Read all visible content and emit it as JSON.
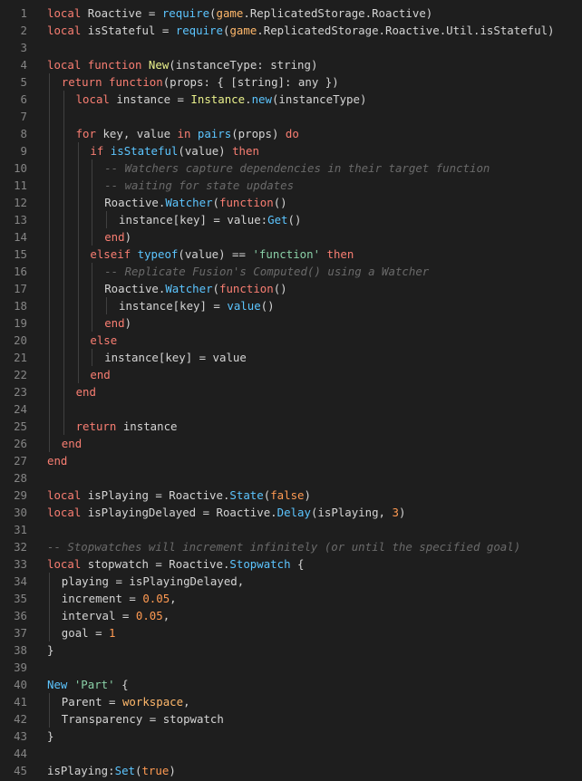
{
  "editor": {
    "language": "Luau",
    "lines": [
      {
        "n": "1",
        "indent": 0,
        "tokens": [
          [
            "kw",
            "local "
          ],
          [
            "",
            "Roactive = "
          ],
          [
            "bi",
            "require"
          ],
          [
            "",
            "("
          ],
          [
            "gm",
            "game"
          ],
          [
            "",
            ".ReplicatedStorage.Roactive)"
          ]
        ]
      },
      {
        "n": "2",
        "indent": 0,
        "tokens": [
          [
            "kw",
            "local "
          ],
          [
            "",
            "isStateful = "
          ],
          [
            "bi",
            "require"
          ],
          [
            "",
            "("
          ],
          [
            "gm",
            "game"
          ],
          [
            "",
            ".ReplicatedStorage.Roactive.Util.isStateful)"
          ]
        ]
      },
      {
        "n": "3",
        "indent": 0,
        "tokens": []
      },
      {
        "n": "4",
        "indent": 0,
        "tokens": [
          [
            "kw",
            "local function "
          ],
          [
            "fn",
            "New"
          ],
          [
            "",
            "(instanceType: "
          ],
          [
            "typ",
            "string"
          ],
          [
            "",
            ")"
          ]
        ]
      },
      {
        "n": "5",
        "indent": 1,
        "tokens": [
          [
            "kw",
            "return function"
          ],
          [
            "",
            "(props: { ["
          ],
          [
            "typ",
            "string"
          ],
          [
            "",
            "]: "
          ],
          [
            "typ",
            "any"
          ],
          [
            "",
            " })"
          ]
        ]
      },
      {
        "n": "6",
        "indent": 2,
        "tokens": [
          [
            "kw",
            "local "
          ],
          [
            "",
            "instance = "
          ],
          [
            "fn",
            "Instance"
          ],
          [
            "",
            "."
          ],
          [
            "bi",
            "new"
          ],
          [
            "",
            "(instanceType)"
          ]
        ]
      },
      {
        "n": "7",
        "indent": 2,
        "tokens": []
      },
      {
        "n": "8",
        "indent": 2,
        "tokens": [
          [
            "kw",
            "for "
          ],
          [
            "",
            "key, value "
          ],
          [
            "kw",
            "in "
          ],
          [
            "bi",
            "pairs"
          ],
          [
            "",
            "(props) "
          ],
          [
            "kw",
            "do"
          ]
        ]
      },
      {
        "n": "9",
        "indent": 3,
        "tokens": [
          [
            "kw",
            "if "
          ],
          [
            "bi",
            "isStateful"
          ],
          [
            "",
            "(value) "
          ],
          [
            "kw",
            "then"
          ]
        ]
      },
      {
        "n": "10",
        "indent": 4,
        "tokens": [
          [
            "cmt",
            "-- Watchers capture dependencies in their target function"
          ]
        ]
      },
      {
        "n": "11",
        "indent": 4,
        "tokens": [
          [
            "cmt",
            "-- waiting for state updates"
          ]
        ]
      },
      {
        "n": "12",
        "indent": 4,
        "tokens": [
          [
            "",
            "Roactive."
          ],
          [
            "bi",
            "Watcher"
          ],
          [
            "",
            "("
          ],
          [
            "kw",
            "function"
          ],
          [
            "",
            "()"
          ]
        ]
      },
      {
        "n": "13",
        "indent": 5,
        "tokens": [
          [
            "",
            "instance[key] = value:"
          ],
          [
            "bi",
            "Get"
          ],
          [
            "",
            "()"
          ]
        ]
      },
      {
        "n": "14",
        "indent": 4,
        "tokens": [
          [
            "kw",
            "end"
          ],
          [
            "",
            ")"
          ]
        ]
      },
      {
        "n": "15",
        "indent": 3,
        "tokens": [
          [
            "kw",
            "elseif "
          ],
          [
            "bi",
            "typeof"
          ],
          [
            "",
            "(value) == "
          ],
          [
            "str",
            "'function'"
          ],
          [
            "kw",
            " then"
          ]
        ]
      },
      {
        "n": "16",
        "indent": 4,
        "tokens": [
          [
            "cmt",
            "-- Replicate Fusion's Computed() using a Watcher"
          ]
        ]
      },
      {
        "n": "17",
        "indent": 4,
        "tokens": [
          [
            "",
            "Roactive."
          ],
          [
            "bi",
            "Watcher"
          ],
          [
            "",
            "("
          ],
          [
            "kw",
            "function"
          ],
          [
            "",
            "()"
          ]
        ]
      },
      {
        "n": "18",
        "indent": 5,
        "tokens": [
          [
            "",
            "instance[key] = "
          ],
          [
            "bi",
            "value"
          ],
          [
            "",
            "()"
          ]
        ]
      },
      {
        "n": "19",
        "indent": 4,
        "tokens": [
          [
            "kw",
            "end"
          ],
          [
            "",
            ")"
          ]
        ]
      },
      {
        "n": "20",
        "indent": 3,
        "tokens": [
          [
            "kw",
            "else"
          ]
        ]
      },
      {
        "n": "21",
        "indent": 4,
        "tokens": [
          [
            "",
            "instance[key] = value"
          ]
        ]
      },
      {
        "n": "22",
        "indent": 3,
        "tokens": [
          [
            "kw",
            "end"
          ]
        ]
      },
      {
        "n": "23",
        "indent": 2,
        "tokens": [
          [
            "kw",
            "end"
          ]
        ]
      },
      {
        "n": "24",
        "indent": 2,
        "tokens": []
      },
      {
        "n": "25",
        "indent": 2,
        "tokens": [
          [
            "kw",
            "return "
          ],
          [
            "",
            "instance"
          ]
        ]
      },
      {
        "n": "26",
        "indent": 1,
        "tokens": [
          [
            "kw",
            "end"
          ]
        ]
      },
      {
        "n": "27",
        "indent": 0,
        "tokens": [
          [
            "kw",
            "end"
          ]
        ]
      },
      {
        "n": "28",
        "indent": 0,
        "tokens": []
      },
      {
        "n": "29",
        "indent": 0,
        "tokens": [
          [
            "kw",
            "local "
          ],
          [
            "",
            "isPlaying = Roactive."
          ],
          [
            "bi",
            "State"
          ],
          [
            "",
            "("
          ],
          [
            "num",
            "false"
          ],
          [
            "",
            ")"
          ]
        ]
      },
      {
        "n": "30",
        "indent": 0,
        "tokens": [
          [
            "kw",
            "local "
          ],
          [
            "",
            "isPlayingDelayed = Roactive."
          ],
          [
            "bi",
            "Delay"
          ],
          [
            "",
            "(isPlaying, "
          ],
          [
            "num",
            "3"
          ],
          [
            "",
            ")"
          ]
        ]
      },
      {
        "n": "31",
        "indent": 0,
        "tokens": []
      },
      {
        "n": "32",
        "indent": 0,
        "tokens": [
          [
            "cmt",
            "-- Stopwatches will increment infinitely (or until the specified goal)"
          ]
        ]
      },
      {
        "n": "33",
        "indent": 0,
        "tokens": [
          [
            "kw",
            "local "
          ],
          [
            "",
            "stopwatch = Roactive."
          ],
          [
            "bi",
            "Stopwatch"
          ],
          [
            "",
            " {"
          ]
        ]
      },
      {
        "n": "34",
        "indent": 1,
        "tokens": [
          [
            "",
            "playing = isPlayingDelayed,"
          ]
        ]
      },
      {
        "n": "35",
        "indent": 1,
        "tokens": [
          [
            "",
            "increment = "
          ],
          [
            "num",
            "0.05"
          ],
          [
            "",
            ","
          ]
        ]
      },
      {
        "n": "36",
        "indent": 1,
        "tokens": [
          [
            "",
            "interval = "
          ],
          [
            "num",
            "0.05"
          ],
          [
            "",
            ","
          ]
        ]
      },
      {
        "n": "37",
        "indent": 1,
        "tokens": [
          [
            "",
            "goal = "
          ],
          [
            "num",
            "1"
          ]
        ]
      },
      {
        "n": "38",
        "indent": 0,
        "tokens": [
          [
            "",
            "}"
          ]
        ]
      },
      {
        "n": "39",
        "indent": 0,
        "tokens": []
      },
      {
        "n": "40",
        "indent": 0,
        "tokens": [
          [
            "bi",
            "New "
          ],
          [
            "str",
            "'Part'"
          ],
          [
            "",
            " {"
          ]
        ]
      },
      {
        "n": "41",
        "indent": 1,
        "tokens": [
          [
            "",
            "Parent = "
          ],
          [
            "gm",
            "workspace"
          ],
          [
            "",
            ","
          ]
        ]
      },
      {
        "n": "42",
        "indent": 1,
        "tokens": [
          [
            "",
            "Transparency = stopwatch"
          ]
        ]
      },
      {
        "n": "43",
        "indent": 0,
        "tokens": [
          [
            "",
            "}"
          ]
        ]
      },
      {
        "n": "44",
        "indent": 0,
        "tokens": []
      },
      {
        "n": "45",
        "indent": 0,
        "tokens": [
          [
            "",
            "isPlaying:"
          ],
          [
            "bi",
            "Set"
          ],
          [
            "",
            "("
          ],
          [
            "num",
            "true"
          ],
          [
            "",
            ")"
          ]
        ]
      }
    ]
  }
}
